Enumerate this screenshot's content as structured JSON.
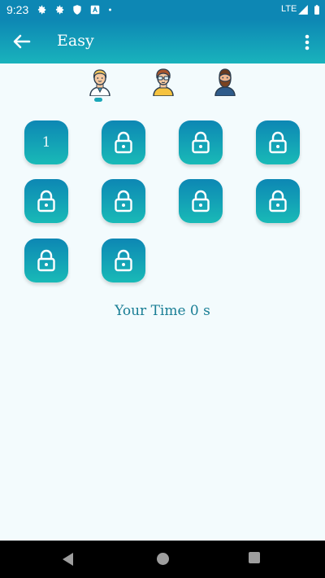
{
  "status_bar": {
    "time": "9:23",
    "network": "LTE",
    "icons": [
      "settings-icon",
      "settings-icon",
      "shield-icon",
      "app-notification-icon",
      "dot-icon",
      "signal-icon",
      "battery-icon"
    ]
  },
  "app_bar": {
    "title": "Easy",
    "back_icon": "arrow-left-icon",
    "menu_icon": "more-vert-icon"
  },
  "avatars": [
    {
      "name": "doctor-avatar",
      "selected": true
    },
    {
      "name": "glasses-avatar",
      "selected": false
    },
    {
      "name": "bearded-avatar",
      "selected": false
    }
  ],
  "levels": [
    {
      "label": "1",
      "locked": false
    },
    {
      "label": "",
      "locked": true
    },
    {
      "label": "",
      "locked": true
    },
    {
      "label": "",
      "locked": true
    },
    {
      "label": "",
      "locked": true
    },
    {
      "label": "",
      "locked": true
    },
    {
      "label": "",
      "locked": true
    },
    {
      "label": "",
      "locked": true
    },
    {
      "label": "",
      "locked": true
    },
    {
      "label": "",
      "locked": true
    }
  ],
  "your_time": "Your Time 0 s",
  "nav": {
    "back_icon": "triangle-back-icon",
    "home_icon": "circle-home-icon",
    "recents_icon": "square-recents-icon"
  },
  "colors": {
    "accent_dark": "#0d87b4",
    "accent_light": "#19bab7",
    "background": "#f3fbfd",
    "text_teal": "#197e95"
  }
}
